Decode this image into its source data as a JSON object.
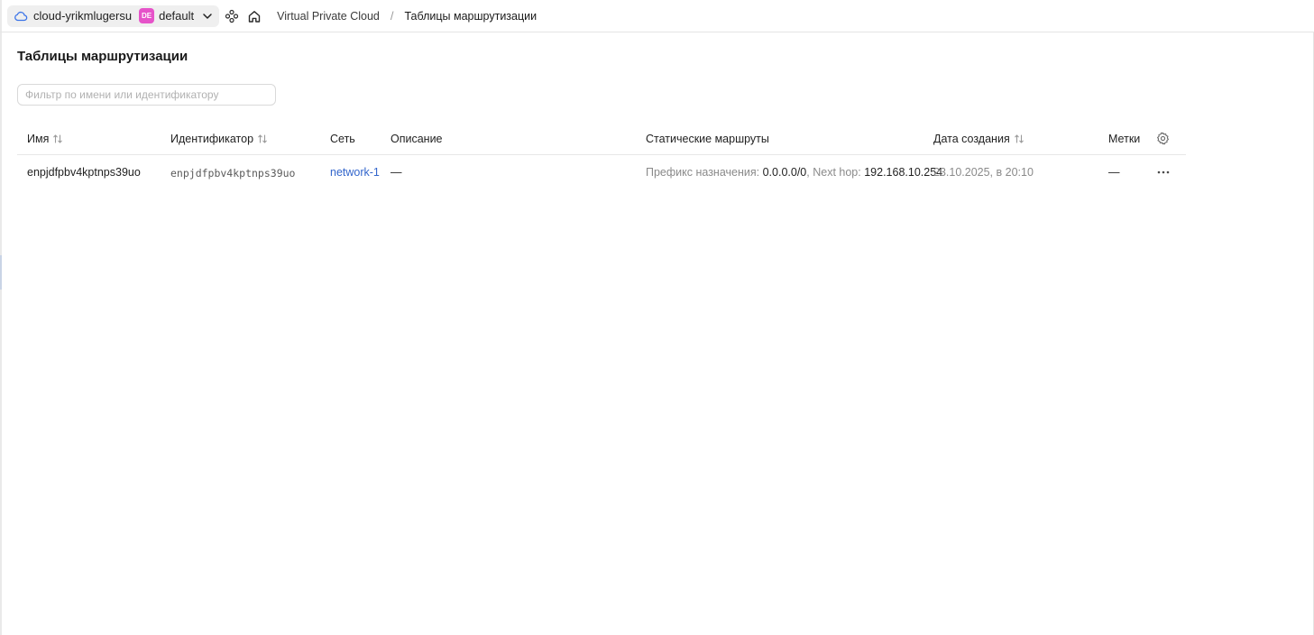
{
  "topbar": {
    "cloud_name": "cloud-yrikmlugersu",
    "folder_badge": "DE",
    "folder_name": "default",
    "breadcrumb": {
      "service": "Virtual Private Cloud",
      "separator": "/",
      "current": "Таблицы маршрутизации"
    }
  },
  "page": {
    "title": "Таблицы маршрутизации",
    "filter_placeholder": "Фильтр по имени или идентификатору"
  },
  "table": {
    "columns": {
      "name": "Имя",
      "id": "Идентификатор",
      "network": "Сеть",
      "description": "Описание",
      "routes": "Статические маршруты",
      "created": "Дата создания",
      "labels": "Метки"
    },
    "rows": [
      {
        "name": "enpjdfpbv4kptnps39uo",
        "id": "enpjdfpbv4kptnps39uo",
        "network": "network-1",
        "description": "—",
        "route_prefix_label": "Префикс назначения:",
        "route_prefix_value": "0.0.0.0/0",
        "route_sep": ",",
        "route_hop_label": "Next hop:",
        "route_hop_value": "192.168.10.254",
        "created": "23.10.2025, в 20:10",
        "labels": "—"
      }
    ]
  },
  "colors": {
    "accent_link": "#3366cc",
    "folder_badge": "#e653c9",
    "cloud_icon": "#3a73e8"
  },
  "icons": [
    "cloud-icon",
    "chevron-down-icon",
    "services-icon",
    "home-icon",
    "sort-icon",
    "settings-gear-icon",
    "more-horizontal-icon"
  ]
}
